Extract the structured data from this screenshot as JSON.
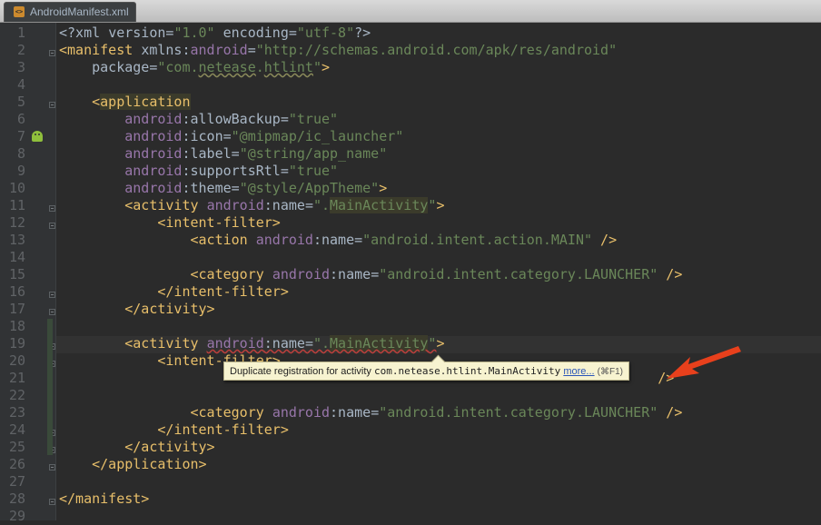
{
  "tab": {
    "filename": "AndroidManifest.xml",
    "icon": "xml-file-icon"
  },
  "line_numbers": [
    "1",
    "2",
    "3",
    "4",
    "5",
    "6",
    "7",
    "8",
    "9",
    "10",
    "11",
    "12",
    "13",
    "14",
    "15",
    "16",
    "17",
    "18",
    "19",
    "20",
    "21",
    "22",
    "23",
    "24",
    "25",
    "26",
    "27",
    "28",
    "29"
  ],
  "code": {
    "l1": {
      "decl_open": "<?xml ",
      "a1": "version",
      "eq1": "=",
      "v1": "\"1.0\"",
      "sp": " ",
      "a2": "encoding",
      "eq2": "=",
      "v2": "\"utf-8\"",
      "decl_close": "?>"
    },
    "l2": {
      "open": "<manifest ",
      "ns_a": "xmlns",
      "colon": ":",
      "ns_b": "android",
      "eq": "=",
      "val": "\"http://schemas.android.com/apk/res/android\""
    },
    "l3": {
      "attr": "package",
      "eq": "=",
      "val_pre": "\"com.",
      "val_wavy": "netease",
      "val_mid": ".",
      "val_wavy2": "htlint",
      "val_post": "\"",
      "close": ">"
    },
    "l5": {
      "open": "<",
      "tag": "application"
    },
    "l6": {
      "ns": "android",
      "attr": ":allowBackup",
      "eq": "=",
      "val": "\"true\""
    },
    "l7": {
      "ns": "android",
      "attr": ":icon",
      "eq": "=",
      "val": "\"@mipmap/ic_launcher\""
    },
    "l8": {
      "ns": "android",
      "attr": ":label",
      "eq": "=",
      "val": "\"@string/app_name\""
    },
    "l9": {
      "ns": "android",
      "attr": ":supportsRtl",
      "eq": "=",
      "val": "\"true\""
    },
    "l10": {
      "ns": "android",
      "attr": ":theme",
      "eq": "=",
      "val": "\"@style/AppTheme\"",
      "close": ">"
    },
    "l11": {
      "open": "<activity ",
      "ns": "android",
      "attr": ":name",
      "eq": "=",
      "val_pre": "\".",
      "val_hl": "MainActivity",
      "val_post": "\"",
      "close": ">"
    },
    "l12": {
      "tag": "<intent-filter>"
    },
    "l13": {
      "open": "<action ",
      "ns": "android",
      "attr": ":name",
      "eq": "=",
      "val": "\"android.intent.action.MAIN\"",
      "close": " />"
    },
    "l15": {
      "open": "<category ",
      "ns": "android",
      "attr": ":name",
      "eq": "=",
      "val": "\"android.intent.category.LAUNCHER\"",
      "close": " />"
    },
    "l16": {
      "tag": "</intent-filter>"
    },
    "l17": {
      "tag": "</activity>"
    },
    "l19": {
      "open": "<activity ",
      "ns": "android",
      "attr": ":name",
      "eq": "=",
      "val_pre": "\".",
      "val_hl": "MainActivity",
      "val_post": "\"",
      "close": ">"
    },
    "l20": {
      "tag": "<intent-filter>"
    },
    "l21": {
      "close": " />"
    },
    "l23": {
      "open": "<category ",
      "ns": "android",
      "attr": ":name",
      "eq": "=",
      "val": "\"android.intent.category.LAUNCHER\"",
      "close": " />"
    },
    "l24": {
      "tag": "</intent-filter>"
    },
    "l25": {
      "tag": "</activity>"
    },
    "l26": {
      "tag": "</application>"
    },
    "l28": {
      "tag": "</manifest>"
    }
  },
  "tooltip": {
    "message": "Duplicate registration for activity ",
    "class_name": "com.netease.htlint.MainActivity",
    "more_link": "more...",
    "shortcut": "(⌘F1)"
  },
  "colors": {
    "background": "#2b2b2b",
    "gutter": "#313335",
    "tag": "#e8bf6a",
    "namespace": "#9876aa",
    "string": "#6a8759",
    "annotation_arrow": "#e8401c",
    "tooltip_bg": "#f7f3d0"
  }
}
